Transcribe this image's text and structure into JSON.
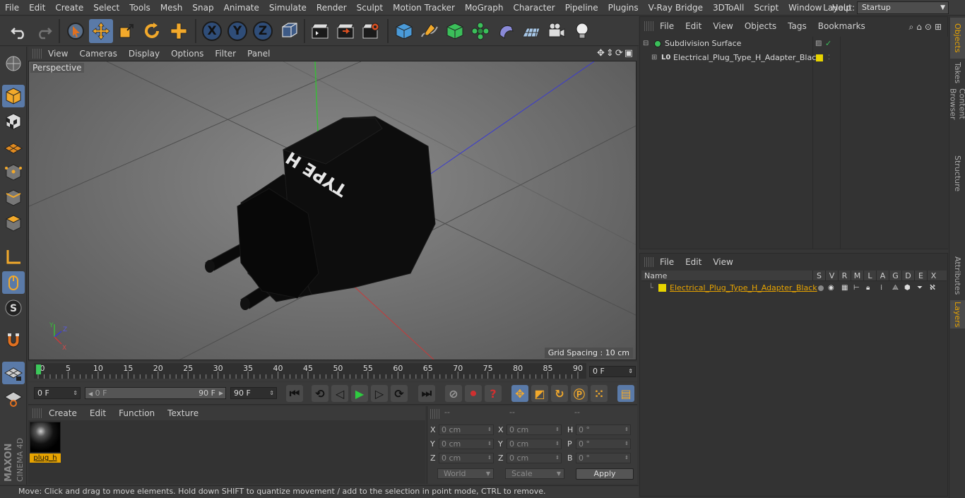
{
  "menubar": {
    "items": [
      "File",
      "Edit",
      "Create",
      "Select",
      "Tools",
      "Mesh",
      "Snap",
      "Animate",
      "Simulate",
      "Render",
      "Sculpt",
      "Motion Tracker",
      "MoGraph",
      "Character",
      "Pipeline",
      "Plugins",
      "V-Ray Bridge",
      "3DToAll",
      "Script",
      "Window",
      "Help"
    ],
    "layout_label": "Layout:",
    "layout_value": "Startup"
  },
  "toolbar": {
    "axis_x": "X",
    "axis_y": "Y",
    "axis_z": "Z"
  },
  "viewport": {
    "menu": [
      "View",
      "Cameras",
      "Display",
      "Options",
      "Filter",
      "Panel"
    ],
    "label": "Perspective",
    "grid_spacing": "Grid Spacing : 10 cm",
    "model_text": "TYPE H",
    "axis_x": "X",
    "axis_y": "Y",
    "axis_z": "Z"
  },
  "timeline": {
    "ticks": [
      "0",
      "5",
      "10",
      "15",
      "20",
      "25",
      "30",
      "35",
      "40",
      "45",
      "50",
      "55",
      "60",
      "65",
      "70",
      "75",
      "80",
      "85",
      "90"
    ],
    "current_frame": "0 F"
  },
  "transport": {
    "start": "0 F",
    "range_start": "0 F",
    "range_end": "90 F",
    "end": "90 F"
  },
  "material_manager": {
    "menu": [
      "Create",
      "Edit",
      "Function",
      "Texture"
    ],
    "material_name": "plug_h"
  },
  "coordinates": {
    "headers": [
      "--",
      "--",
      "--"
    ],
    "rows": [
      {
        "l1": "X",
        "v1": "0 cm",
        "l2": "X",
        "v2": "0 cm",
        "l3": "H",
        "v3": "0 °"
      },
      {
        "l1": "Y",
        "v1": "0 cm",
        "l2": "Y",
        "v2": "0 cm",
        "l3": "P",
        "v3": "0 °"
      },
      {
        "l1": "Z",
        "v1": "0 cm",
        "l2": "Z",
        "v2": "0 cm",
        "l3": "B",
        "v3": "0 °"
      }
    ],
    "mode": "World",
    "scale": "Scale",
    "apply": "Apply"
  },
  "status": {
    "text": "Move: Click and drag to move elements. Hold down SHIFT to quantize movement / add to the selection in point mode, CTRL to remove."
  },
  "object_manager": {
    "menu": [
      "File",
      "Edit",
      "View",
      "Objects",
      "Tags",
      "Bookmarks"
    ],
    "objects": [
      {
        "name": "Subdivision Surface"
      },
      {
        "name": "Electrical_Plug_Type_H_Adapter_Black"
      }
    ]
  },
  "layer_manager": {
    "menu": [
      "File",
      "Edit",
      "View"
    ],
    "header_name": "Name",
    "columns": [
      "S",
      "V",
      "R",
      "M",
      "L",
      "A",
      "G",
      "D",
      "E",
      "X"
    ],
    "layer_name": "Electrical_Plug_Type_H_Adapter_Black"
  },
  "side_tabs": [
    "Objects",
    "Takes",
    "Content Browser",
    "Structure",
    "Attributes",
    "Layers"
  ],
  "brand": {
    "maxon": "MAXON",
    "product": "CINEMA 4D"
  },
  "colors": {
    "accent_orange": "#e8a400",
    "selection_blue": "#5a7aa8",
    "layer_yellow": "#e8d400"
  }
}
